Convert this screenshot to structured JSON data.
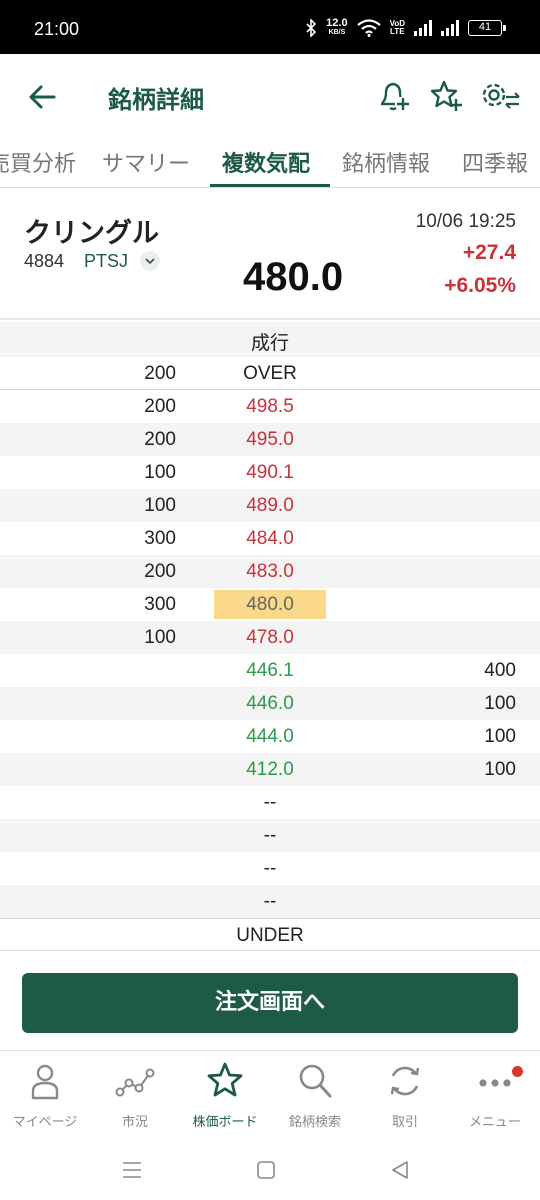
{
  "status_bar": {
    "time": "21:00",
    "net_speed_value": "12.0",
    "net_speed_unit": "KB/S",
    "volte_top": "VoD",
    "volte_bottom": "LTE",
    "battery": "41"
  },
  "header": {
    "title": "銘柄詳細",
    "icons": [
      "back-arrow-icon",
      "bell-plus-icon",
      "star-plus-icon",
      "settings-swap-icon"
    ]
  },
  "tabs": {
    "items": [
      {
        "label": "売買分析"
      },
      {
        "label": "サマリー"
      },
      {
        "label": "複数気配"
      },
      {
        "label": "銘柄情報"
      },
      {
        "label": "四季報"
      }
    ],
    "active": "複数気配"
  },
  "stock": {
    "name": "クリングル",
    "code": "4884",
    "market": "PTSJ",
    "price": "480.0",
    "timestamp": "10/06 19:25",
    "change": "+27.4",
    "change_pct": "+6.05%"
  },
  "order_book": {
    "market_order_label": "成行",
    "over_row": {
      "ask_qty": "200",
      "price": "OVER"
    },
    "asks": [
      {
        "qty": "200",
        "price": "498.5"
      },
      {
        "qty": "200",
        "price": "495.0"
      },
      {
        "qty": "100",
        "price": "490.1"
      },
      {
        "qty": "100",
        "price": "489.0"
      },
      {
        "qty": "300",
        "price": "484.0"
      },
      {
        "qty": "200",
        "price": "483.0"
      },
      {
        "qty": "300",
        "price": "480.0",
        "current": true
      },
      {
        "qty": "100",
        "price": "478.0"
      }
    ],
    "bids": [
      {
        "price": "446.1",
        "qty": "400"
      },
      {
        "price": "446.0",
        "qty": "100"
      },
      {
        "price": "444.0",
        "qty": "100"
      },
      {
        "price": "412.0",
        "qty": "100"
      }
    ],
    "empty_rows": [
      "--",
      "--",
      "--",
      "--"
    ],
    "under_label": "UNDER"
  },
  "order_button": {
    "label": "注文画面へ"
  },
  "bottom_nav": {
    "items": [
      {
        "label": "マイページ",
        "icon": "person-icon"
      },
      {
        "label": "市況",
        "icon": "market-chart-icon"
      },
      {
        "label": "株価ボード",
        "icon": "star-icon",
        "active": true
      },
      {
        "label": "銘柄検索",
        "icon": "search-icon"
      },
      {
        "label": "取引",
        "icon": "refresh-cycle-icon"
      },
      {
        "label": "メニュー",
        "icon": "more-dots-icon"
      }
    ]
  },
  "colors": {
    "brand_green": "#1c5a48",
    "ask_red": "#c8323a",
    "bid_green": "#2c9a4c",
    "current_price_highlight": "#fbd98a"
  }
}
